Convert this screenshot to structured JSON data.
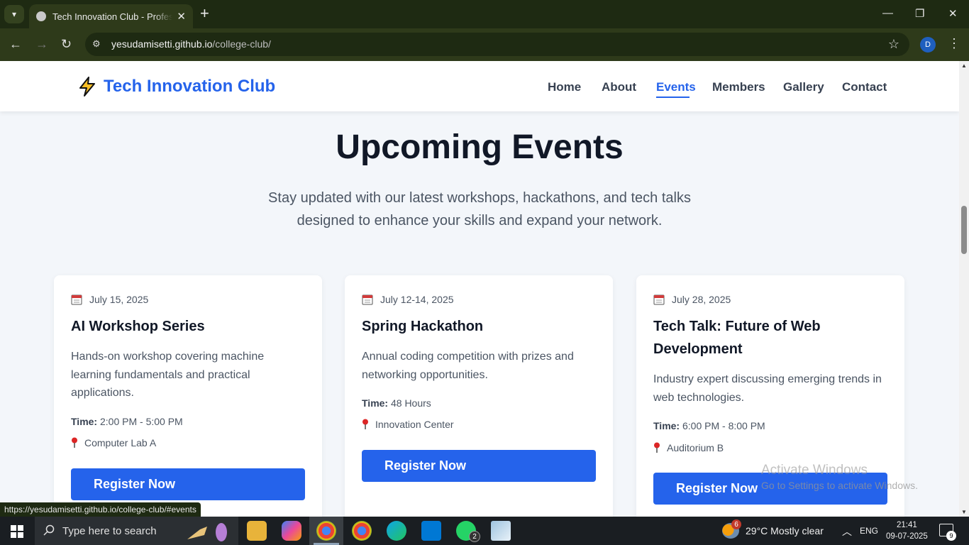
{
  "browser": {
    "tab_title": "Tech Innovation Club - Professional",
    "tab_close": "✕",
    "new_tab": "+",
    "url_host": "yesudamisetti.github.io",
    "url_path": "/college-club/",
    "profile_initial": "D",
    "status_url": "https://yesudamisetti.github.io/college-club/#events",
    "accent_color": "#2e3a1a"
  },
  "site": {
    "logo_text": "Tech Innovation Club",
    "brand_color": "#2563eb",
    "nav": [
      {
        "label": "Home"
      },
      {
        "label": "About"
      },
      {
        "label": "Events",
        "active": true
      },
      {
        "label": "Members"
      },
      {
        "label": "Gallery"
      },
      {
        "label": "Contact"
      }
    ]
  },
  "events_section": {
    "title": "Upcoming Events",
    "subtitle": "Stay updated with our latest workshops, hackathons, and tech talks designed to enhance your skills and expand your network."
  },
  "events": [
    {
      "date": "July 15, 2025",
      "title": "AI Workshop Series",
      "description": "Hands-on workshop covering machine learning fundamentals and practical applications.",
      "time_label": "Time:",
      "time": "2:00 PM - 5:00 PM",
      "location": "Computer Lab A",
      "button": "Register Now"
    },
    {
      "date": "July 12-14, 2025",
      "title": "Spring Hackathon",
      "description": "Annual coding competition with prizes and networking opportunities.",
      "time_label": "Time:",
      "time": "48 Hours",
      "location": "Innovation Center",
      "button": "Register Now"
    },
    {
      "date": "July 28, 2025",
      "title": "Tech Talk: Future of Web Development",
      "description": "Industry expert discussing emerging trends in web technologies.",
      "time_label": "Time:",
      "time": "6:00 PM - 8:00 PM",
      "location": "Auditorium B",
      "button": "Register Now"
    }
  ],
  "watermark": {
    "line1": "Activate Windows",
    "line2": "Go to Settings to activate Windows."
  },
  "taskbar": {
    "search_placeholder": "Type here to search",
    "whatsapp_badge": "2",
    "weather_badge": "6",
    "weather": "29°C  Mostly clear",
    "language": "ENG",
    "time": "21:41",
    "date": "09-07-2025",
    "notifications": "9"
  }
}
